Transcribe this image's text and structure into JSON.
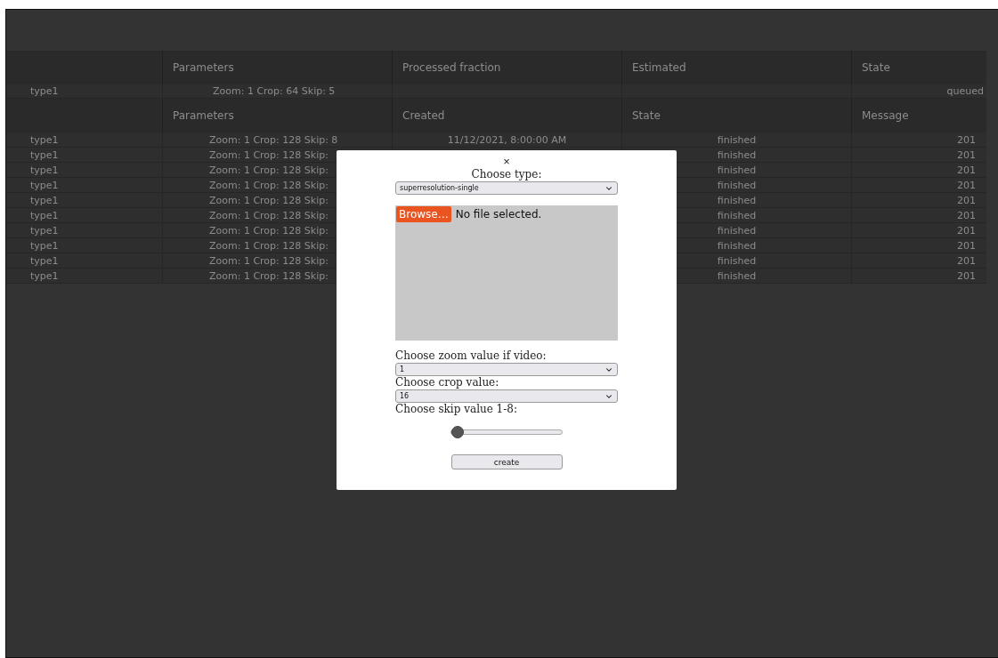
{
  "queue_table": {
    "columns": [
      "Parameters",
      "Processed fraction",
      "Estimated",
      "State"
    ],
    "rows": [
      {
        "type": "type1",
        "parameters": "Zoom: 1 Crop: 64 Skip: 5",
        "state": "queued"
      }
    ]
  },
  "history_table": {
    "columns": [
      "Parameters",
      "Created",
      "State",
      "Message"
    ],
    "rows": [
      {
        "type": "type1",
        "parameters": "Zoom: 1 Crop: 128 Skip: 8",
        "created": "11/12/2021, 8:00:00 AM",
        "state": "finished",
        "message": "201"
      },
      {
        "type": "type1",
        "parameters": "Zoom: 1 Crop: 128 Skip:",
        "state": "finished",
        "message": "201"
      },
      {
        "type": "type1",
        "parameters": "Zoom: 1 Crop: 128 Skip:",
        "state": "finished",
        "message": "201"
      },
      {
        "type": "type1",
        "parameters": "Zoom: 1 Crop: 128 Skip:",
        "state": "finished",
        "message": "201"
      },
      {
        "type": "type1",
        "parameters": "Zoom: 1 Crop: 128 Skip:",
        "state": "finished",
        "message": "201"
      },
      {
        "type": "type1",
        "parameters": "Zoom: 1 Crop: 128 Skip:",
        "state": "finished",
        "message": "201"
      },
      {
        "type": "type1",
        "parameters": "Zoom: 1 Crop: 128 Skip:",
        "state": "finished",
        "message": "201"
      },
      {
        "type": "type1",
        "parameters": "Zoom: 1 Crop: 128 Skip:",
        "state": "finished",
        "message": "201"
      },
      {
        "type": "type1",
        "parameters": "Zoom: 1 Crop: 128 Skip:",
        "state": "finished",
        "message": "201"
      },
      {
        "type": "type1",
        "parameters": "Zoom: 1 Crop: 128 Skip:",
        "state": "finished",
        "message": "201"
      }
    ]
  },
  "dialog": {
    "close": "×",
    "type_label": "Choose type:",
    "type_value": "superresolution-single",
    "file": {
      "button": "Browse…",
      "status": "No file selected."
    },
    "zoom_label": "Choose zoom value if video:",
    "zoom_value": "1",
    "crop_label": "Choose crop value:",
    "crop_value": "16",
    "skip_label": "Choose skip value 1-8:",
    "skip": {
      "level": 0
    },
    "create_button": "create"
  }
}
